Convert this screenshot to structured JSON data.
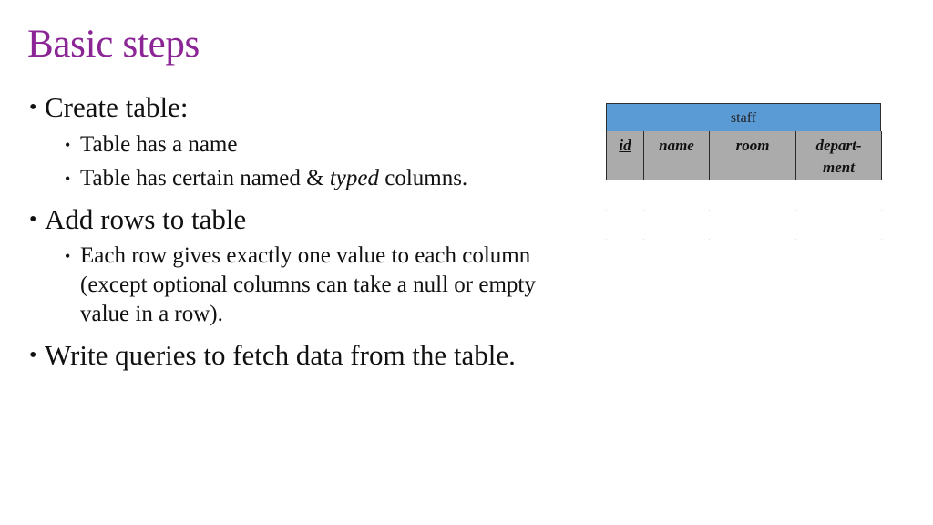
{
  "slide": {
    "title": "Basic steps",
    "title_color": "#8b2494",
    "bullets": [
      {
        "text": "Create table:",
        "children": [
          {
            "text": "Table has a name"
          },
          {
            "text_before": "Table has certain named & ",
            "text_italic": "typed",
            "text_after": " columns."
          }
        ]
      },
      {
        "text": "Add rows to table",
        "children": [
          {
            "text": "Each row gives exactly one value to each column (except optional columns can take a null or empty value in a row)."
          }
        ]
      },
      {
        "text": "Write queries to fetch data from the table.",
        "children": []
      }
    ]
  },
  "table": {
    "name": "staff",
    "header_color": "#5b9bd5",
    "column_header_color": "#ababab",
    "columns": [
      {
        "label": "id",
        "primary_key": true
      },
      {
        "label": "name",
        "primary_key": false
      },
      {
        "label": "room",
        "primary_key": false
      },
      {
        "label": "depart-ment",
        "primary_key": false
      }
    ],
    "rows": []
  }
}
